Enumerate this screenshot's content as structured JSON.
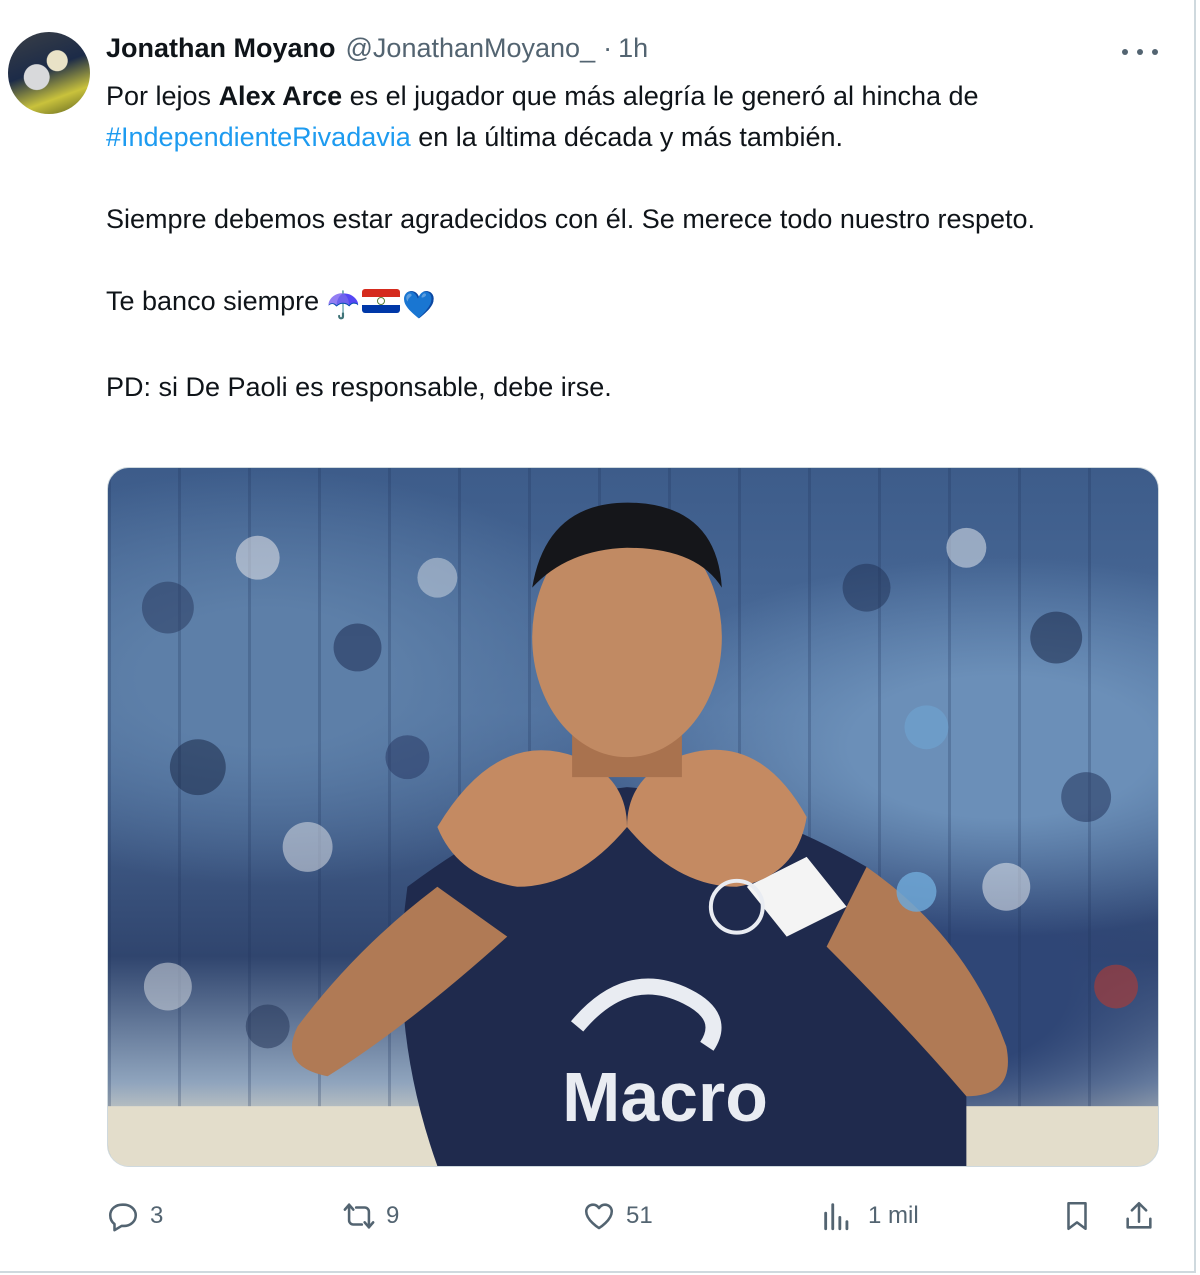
{
  "tweet": {
    "author_name": "Jonathan Moyano",
    "author_handle": "@JonathanMoyano_",
    "separator": "·",
    "time": "1h",
    "line1_pre": "Por lejos ",
    "line1_bold": "Alex Arce",
    "line1_post": " es el jugador que más alegría le generó al hincha de",
    "hashtag": "#IndependienteRivadavia",
    "line2_post": " en la última década y más también.",
    "para2": "Siempre debemos estar agradecidos con él. Se merece todo nuestro respeto.",
    "para3": "Te banco siempre ",
    "para3_emoji_umbrella": "☂️",
    "para3_emoji_heart": "💙",
    "para4": "PD: si De Paoli es responsable, debe irse.",
    "media": {
      "sponsor_text": "Macro"
    }
  },
  "actions": {
    "replies": "3",
    "reposts": "9",
    "likes": "51",
    "views": "1 mil"
  },
  "icons": {
    "more": "more-dots-icon",
    "reply": "reply-icon",
    "repost": "repost-icon",
    "like": "heart-icon",
    "views": "views-icon",
    "bookmark": "bookmark-icon",
    "share": "share-icon"
  },
  "colors": {
    "text": "#0f1419",
    "secondary": "#536471",
    "link": "#1d9bf0",
    "jersey": "#1f2a4d"
  }
}
